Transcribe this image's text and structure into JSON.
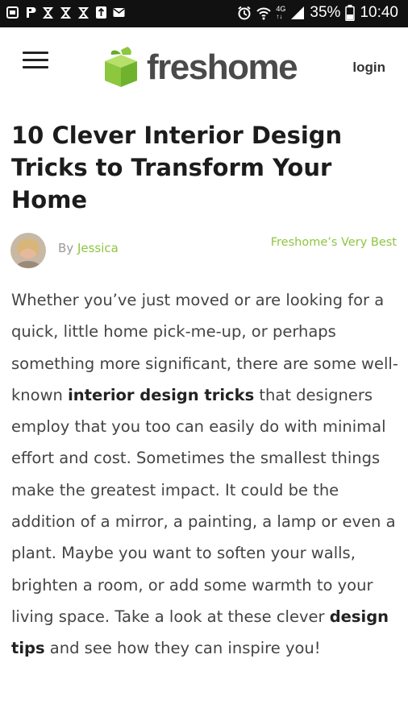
{
  "status_bar": {
    "battery": "35%",
    "time": "10:40",
    "icons": [
      "gallery-icon",
      "pin-icon",
      "tv-icon",
      "tv-icon",
      "tv-icon",
      "usb-icon",
      "mail-icon",
      "alarm-icon",
      "wifi-icon",
      "network-4g-icon",
      "signal-icon",
      "battery-icon"
    ]
  },
  "header": {
    "logo_text": "freshome",
    "login_label": "login",
    "brand_color": "#8dc63f"
  },
  "article": {
    "title": "10 Clever Interior Design Tricks to Transform Your Home",
    "by_label": "By",
    "author": "Jessica",
    "category": "Freshome’s Very Best",
    "body": {
      "p1": "Whether you’ve just moved or are looking for a quick, little home pick-me-up, or perhaps something more significant, there are some well-known",
      "link1": "interior design tricks",
      "p2": "that designers employ that you too can easily do with minimal effort and cost.  Sometimes the smallest things make the greatest impact. It could be the addition of a mirror, a painting, a lamp or even a plant. Maybe you want to soften your walls, brighten a room, or add some warmth to your living space. Take a look at these clever",
      "link2": "design tips",
      "p3": "and see how they can inspire you!"
    }
  }
}
